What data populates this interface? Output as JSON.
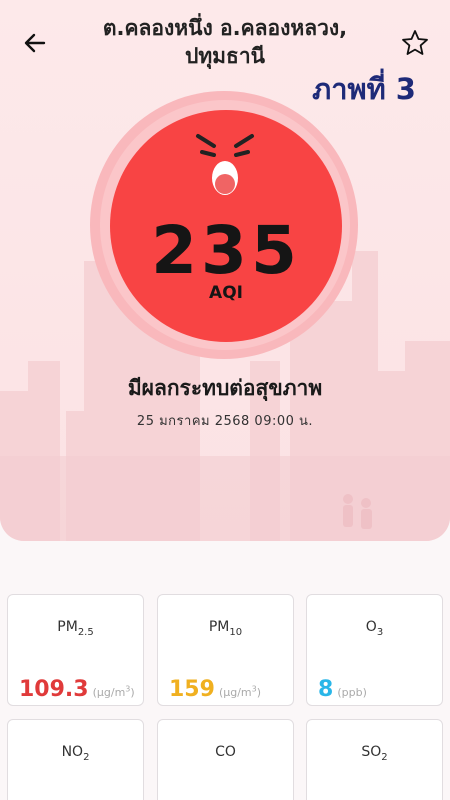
{
  "header": {
    "location_line1": "ต.คลองหนึ่ง อ.คลองหลวง,",
    "location_line2": "ปทุมธานี",
    "watermark": "ภาพที่ 3"
  },
  "aqi": {
    "value": "235",
    "unit": "AQI",
    "status": "มีผลกระทบต่อสุขภาพ",
    "datetime": "25 มกราคม 2568  09:00 น.",
    "color": "#f84444"
  },
  "pollutants": [
    {
      "name": "PM",
      "sub": "2.5",
      "value": "109.3",
      "unit": "µg/m",
      "unit_sup": "3",
      "color": "#e03a3a"
    },
    {
      "name": "PM",
      "sub": "10",
      "value": "159",
      "unit": "µg/m",
      "unit_sup": "3",
      "color": "#f0b020"
    },
    {
      "name": "O",
      "sub": "3",
      "value": "8",
      "unit": "ppb",
      "unit_sup": "",
      "color": "#29b6e8"
    },
    {
      "name": "NO",
      "sub": "2",
      "value": "",
      "unit": "",
      "unit_sup": "",
      "color": "#333333"
    },
    {
      "name": "CO",
      "sub": "",
      "value": "",
      "unit": "",
      "unit_sup": "",
      "color": "#333333"
    },
    {
      "name": "SO",
      "sub": "2",
      "value": "",
      "unit": "",
      "unit_sup": "",
      "color": "#333333"
    }
  ],
  "icons": {
    "back": "arrow-left-icon",
    "favorite": "star-outline-icon",
    "face": "angry-face-icon"
  }
}
